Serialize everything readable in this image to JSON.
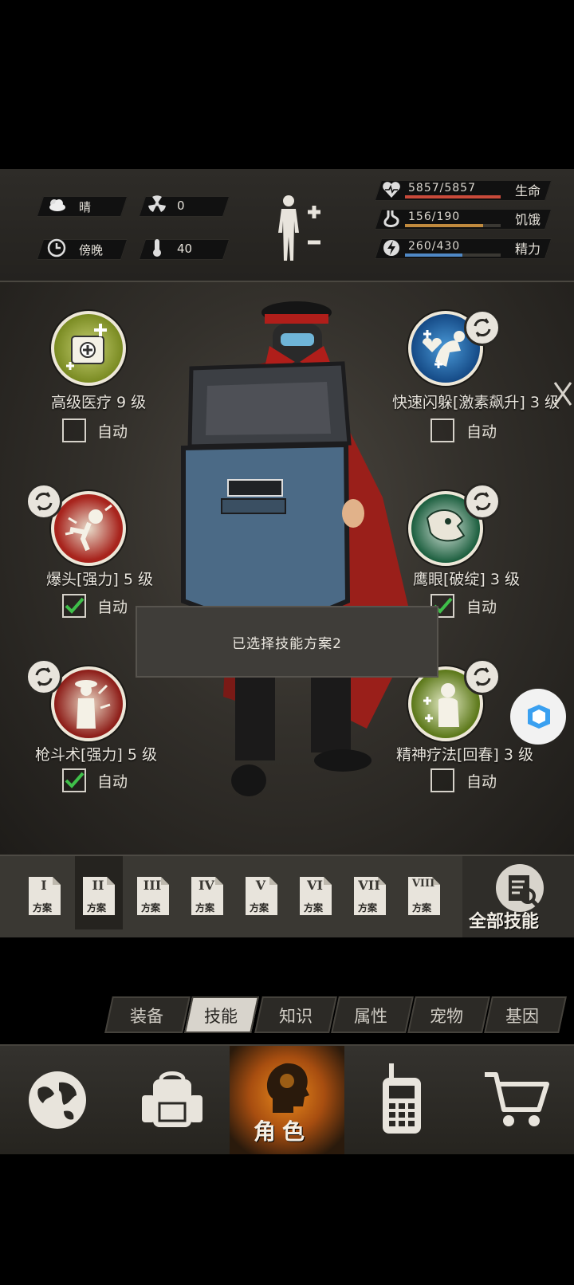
{
  "status": {
    "weather": "晴",
    "radiation": "0",
    "time_of_day": "傍晚",
    "temperature": "40",
    "health": {
      "value": "5857/5857",
      "label": "生命",
      "fill": 1.0,
      "color": "#c94a3a"
    },
    "hunger": {
      "value": "156/190",
      "label": "饥饿",
      "fill": 0.82,
      "color": "#c08a3e"
    },
    "energy": {
      "value": "260/430",
      "label": "精力",
      "fill": 0.6,
      "color": "#4f88c6"
    }
  },
  "skills": [
    {
      "name": "高级医疗 9 级",
      "auto_label": "自动",
      "auto": false,
      "icon": "medkit-icon"
    },
    {
      "name": "快速闪躲[激素飙升] 3 级",
      "auto_label": "自动",
      "auto": false,
      "icon": "dodge-icon"
    },
    {
      "name": "爆头[强力] 5 级",
      "auto_label": "自动",
      "auto": true,
      "icon": "headshot-icon"
    },
    {
      "name": "鹰眼[破绽] 3 级",
      "auto_label": "自动",
      "auto": true,
      "icon": "eagle-eye-icon"
    },
    {
      "name": "枪斗术[强力] 5 级",
      "auto_label": "自动",
      "auto": true,
      "icon": "gun-kata-icon"
    },
    {
      "name": "精神疗法[回春] 3 级",
      "auto_label": "自动",
      "auto": false,
      "icon": "mental-therapy-icon"
    }
  ],
  "toast": "已选择技能方案2",
  "plans": [
    {
      "num": "I",
      "label": "方案"
    },
    {
      "num": "II",
      "label": "方案"
    },
    {
      "num": "III",
      "label": "方案"
    },
    {
      "num": "IV",
      "label": "方案"
    },
    {
      "num": "V",
      "label": "方案"
    },
    {
      "num": "VI",
      "label": "方案"
    },
    {
      "num": "VII",
      "label": "方案"
    },
    {
      "num": "VIII",
      "label": "方案"
    }
  ],
  "selected_plan": 2,
  "all_skills_label": "全部技能",
  "tabs": [
    "装备",
    "技能",
    "知识",
    "属性",
    "宠物",
    "基因"
  ],
  "active_tab": "技能",
  "nav": {
    "role_label": "角色"
  }
}
